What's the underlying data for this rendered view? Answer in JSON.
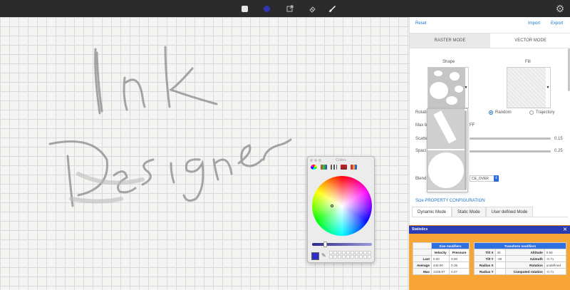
{
  "toolbar": {
    "icons": [
      "white-square",
      "color-dot",
      "export-arrow",
      "eraser",
      "brush"
    ],
    "active_color": "#3038b8",
    "settings_icon": "gear"
  },
  "canvas": {
    "handwritten_text": [
      "Ink",
      "Designer"
    ],
    "grid_color": "#d9d9d9",
    "background": "#f4f4f2"
  },
  "colors_panel": {
    "title": "Colors",
    "current_color": "#2f2fc8"
  },
  "sidebar": {
    "reset": "Reset",
    "import": "Import",
    "export": "Export",
    "tabs": [
      "RASTER MODE",
      "VECTOR MODE"
    ],
    "active_tab": "RASTER MODE",
    "shape_label": "Shape",
    "fill_label": "Fill",
    "rotation_label": "Rotati",
    "rotation_options": [
      "Random",
      "Trajectory"
    ],
    "rotation_selected": "Random",
    "max_label": "Max b",
    "toggle_text": "FF",
    "scatter_label": "Scatte",
    "scatter_value": "0.15",
    "spacing_label": "Spaci",
    "spacing_value": "0.25",
    "blend_label": "Blend",
    "blend_value": "CE_OVER",
    "section_title": "Size PROPERTY CONFIGURATION",
    "sub_tabs": [
      "Dynamic Mode",
      "Static Mode",
      "User defined Mode"
    ],
    "sub_tab_active": "Dynamic Mode"
  },
  "statistics": {
    "title": "Statistics",
    "size_modifiers": {
      "title": "Size modifiers",
      "columns": [
        "Velocity",
        "Pressure"
      ],
      "rows": [
        {
          "label": "Last",
          "values": [
            "0.00",
            "0.00"
          ]
        },
        {
          "label": "Average",
          "values": [
            "440.90",
            "0.35"
          ]
        },
        {
          "label": "Max",
          "values": [
            "1238.87",
            "0.47"
          ]
        }
      ]
    },
    "transform_modifiers": {
      "title": "Transform modifiers",
      "rows": [
        {
          "l1": "Tilt X",
          "v1": "34",
          "l2": "Altitude",
          "v2": "0.84"
        },
        {
          "l1": "Tilt Y",
          "v1": "-30",
          "l2": "Azimuth",
          "v2": "-0.71"
        },
        {
          "l1": "Radius X",
          "v1": "",
          "l2": "Rotation",
          "v2": "undefined"
        },
        {
          "l1": "Radius Y",
          "v1": "",
          "l2": "Computed rotation",
          "v2": "-0.71"
        }
      ]
    }
  }
}
